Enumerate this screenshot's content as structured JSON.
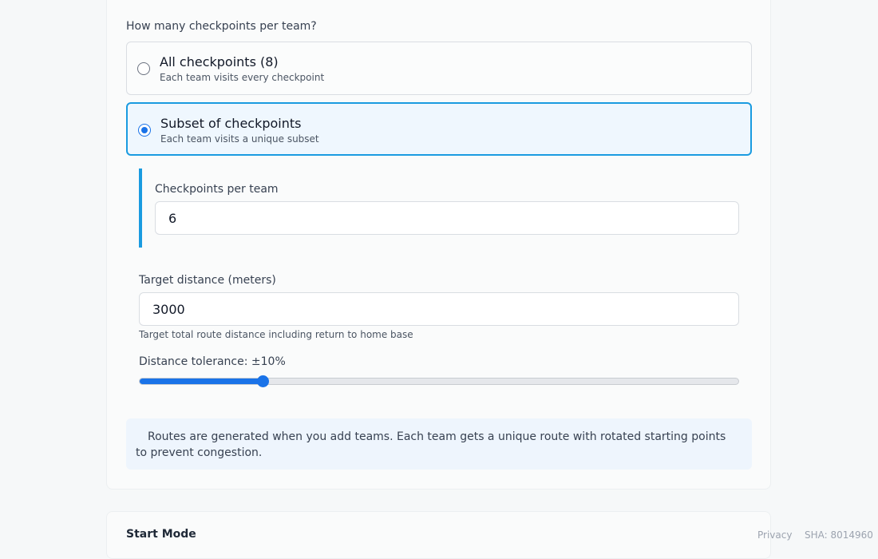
{
  "checkpoints_question": "How many checkpoints per team?",
  "options": [
    {
      "title": "All checkpoints (8)",
      "description": "Each team visits every checkpoint",
      "selected": false
    },
    {
      "title": "Subset of checkpoints",
      "description": "Each team visits a unique subset",
      "selected": true
    }
  ],
  "checkpoints_per_team": {
    "label": "Checkpoints per team",
    "value": "6"
  },
  "target_distance": {
    "label": "Target distance (meters)",
    "value": "3000",
    "hint": "Target total route distance including return to home base"
  },
  "distance_tolerance": {
    "label": "Distance tolerance: ±10%",
    "value_fraction": 0.205
  },
  "info_text": "Routes are generated when you add teams. Each team gets a unique route with rotated starting points to prevent congestion.",
  "start_mode_label": "Start Mode",
  "footer": {
    "privacy": "Privacy",
    "sha": "SHA: 8014960"
  },
  "colors": {
    "accent": "#1a73e8",
    "selected_border": "#1a9be0",
    "info_bg": "#eef5fd"
  }
}
